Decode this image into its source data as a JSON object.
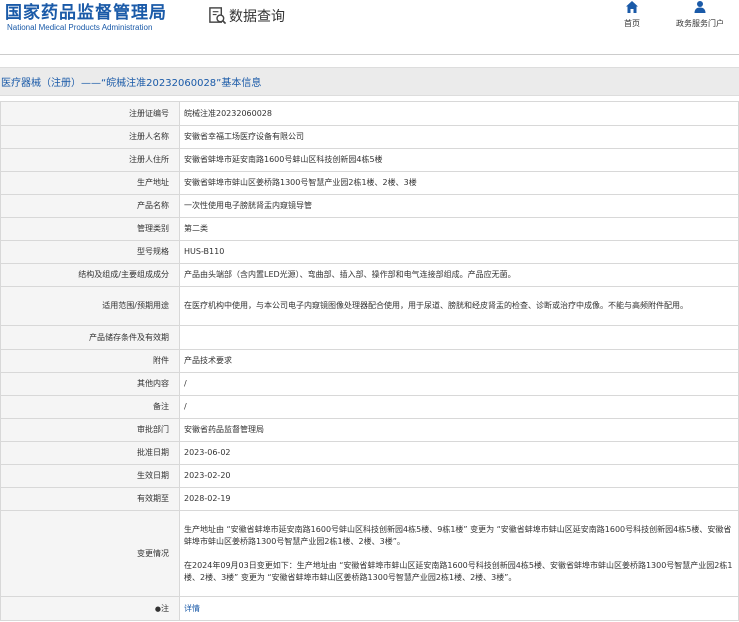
{
  "header": {
    "logo_cn": "国家药品监督管理局",
    "logo_en": "National Medical Products Administration",
    "search_title": "数据查询",
    "nav": [
      {
        "label": "首页",
        "icon": "home-icon"
      },
      {
        "label": "政务服务门户",
        "icon": "user-icon"
      }
    ]
  },
  "title_bar": "医疗器械（注册）——“皖械注准20232060028”基本信息",
  "rows": [
    {
      "label": "注册证编号",
      "value": "皖械注准20232060028"
    },
    {
      "label": "注册人名称",
      "value": "安徽省幸福工场医疗设备有限公司"
    },
    {
      "label": "注册人住所",
      "value": "安徽省蚌埠市延安南路1600号蚌山区科技创新园4栋5楼"
    },
    {
      "label": "生产地址",
      "value": "安徽省蚌埠市蚌山区姜桥路1300号智慧产业园2栋1楼、2楼、3楼"
    },
    {
      "label": "产品名称",
      "value": "一次性使用电子膀胱肾盂内窥镜导管"
    },
    {
      "label": "管理类别",
      "value": "第二类"
    },
    {
      "label": "型号规格",
      "value": "HUS-B110"
    },
    {
      "label": "结构及组成/主要组成成分",
      "value": "产品由头端部（含内置LED光源）、弯曲部、插入部、操作部和电气连接部组成。产品应无菌。"
    },
    {
      "label": "适用范围/预期用途",
      "value": "在医疗机构中使用，与本公司电子内窥镜图像处理器配合使用，用于尿道、膀胱和经皮肾盂的检查、诊断或治疗中成像。不能与高频附件配用。"
    },
    {
      "label": "产品储存条件及有效期",
      "value": ""
    },
    {
      "label": "附件",
      "value": "产品技术要求"
    },
    {
      "label": "其他内容",
      "value": "/"
    },
    {
      "label": "备注",
      "value": "/"
    },
    {
      "label": "审批部门",
      "value": "安徽省药品监督管理局"
    },
    {
      "label": "批准日期",
      "value": "2023-06-02"
    },
    {
      "label": "生效日期",
      "value": "2023-02-20"
    },
    {
      "label": "有效期至",
      "value": "2028-02-19"
    }
  ],
  "change": {
    "label": "变更情况",
    "p1": "生产地址由 “安徽省蚌埠市延安南路1600号蚌山区科技创新园4栋5楼、9栋1楼” 变更为 “安徽省蚌埠市蚌山区延安南路1600号科技创新园4栋5楼、安徽省蚌埠市蚌山区姜桥路1300号智慧产业园2栋1楼、2楼、3楼”。",
    "p2": "在2024年09月03日变更如下：生产地址由 “安徽省蚌埠市蚌山区延安南路1600号科技创新园4栋5楼、安徽省蚌埠市蚌山区姜桥路1300号智慧产业园2栋1楼、2楼、3楼” 变更为 “安徽省蚌埠市蚌山区姜桥路1300号智慧产业园2栋1楼、2楼、3楼”。"
  },
  "note": {
    "label": "注",
    "link": "详情"
  },
  "colors": {
    "brand": "#1a5aa8",
    "label_bg": "#f5f5f5",
    "title_bg": "#ebebeb",
    "border": "#d8d8d8"
  }
}
